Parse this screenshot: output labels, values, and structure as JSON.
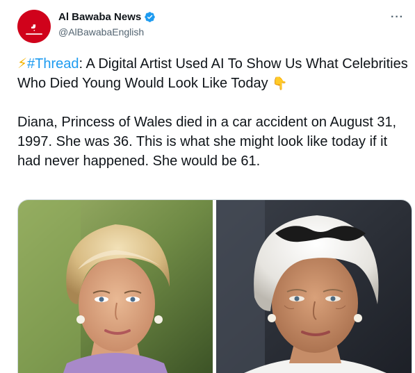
{
  "account": {
    "display_name": "Al Bawaba News",
    "handle": "@AlBawabaEnglish",
    "avatar_glyph": "ﺑ",
    "avatar_color": "#d0021b",
    "verified_color": "#1d9bf0"
  },
  "menu": {
    "more_label": "···"
  },
  "tweet": {
    "line1": {
      "emoji": "⚡",
      "hashtag": "#Thread",
      "text": ": A Digital Artist Used AI To Show Us What Celebrities Who Died Young Would Look Like Today ",
      "end_emoji": "👇"
    },
    "paragraph2": "Diana, Princess of Wales died in a car accident on August 31, 1997. She was 36. This is what she might look like today if it had never happened. She would be 61."
  },
  "colors": {
    "link": "#1d9bf0",
    "text": "#0f1419",
    "secondary": "#536471",
    "border": "#cfd9de"
  }
}
